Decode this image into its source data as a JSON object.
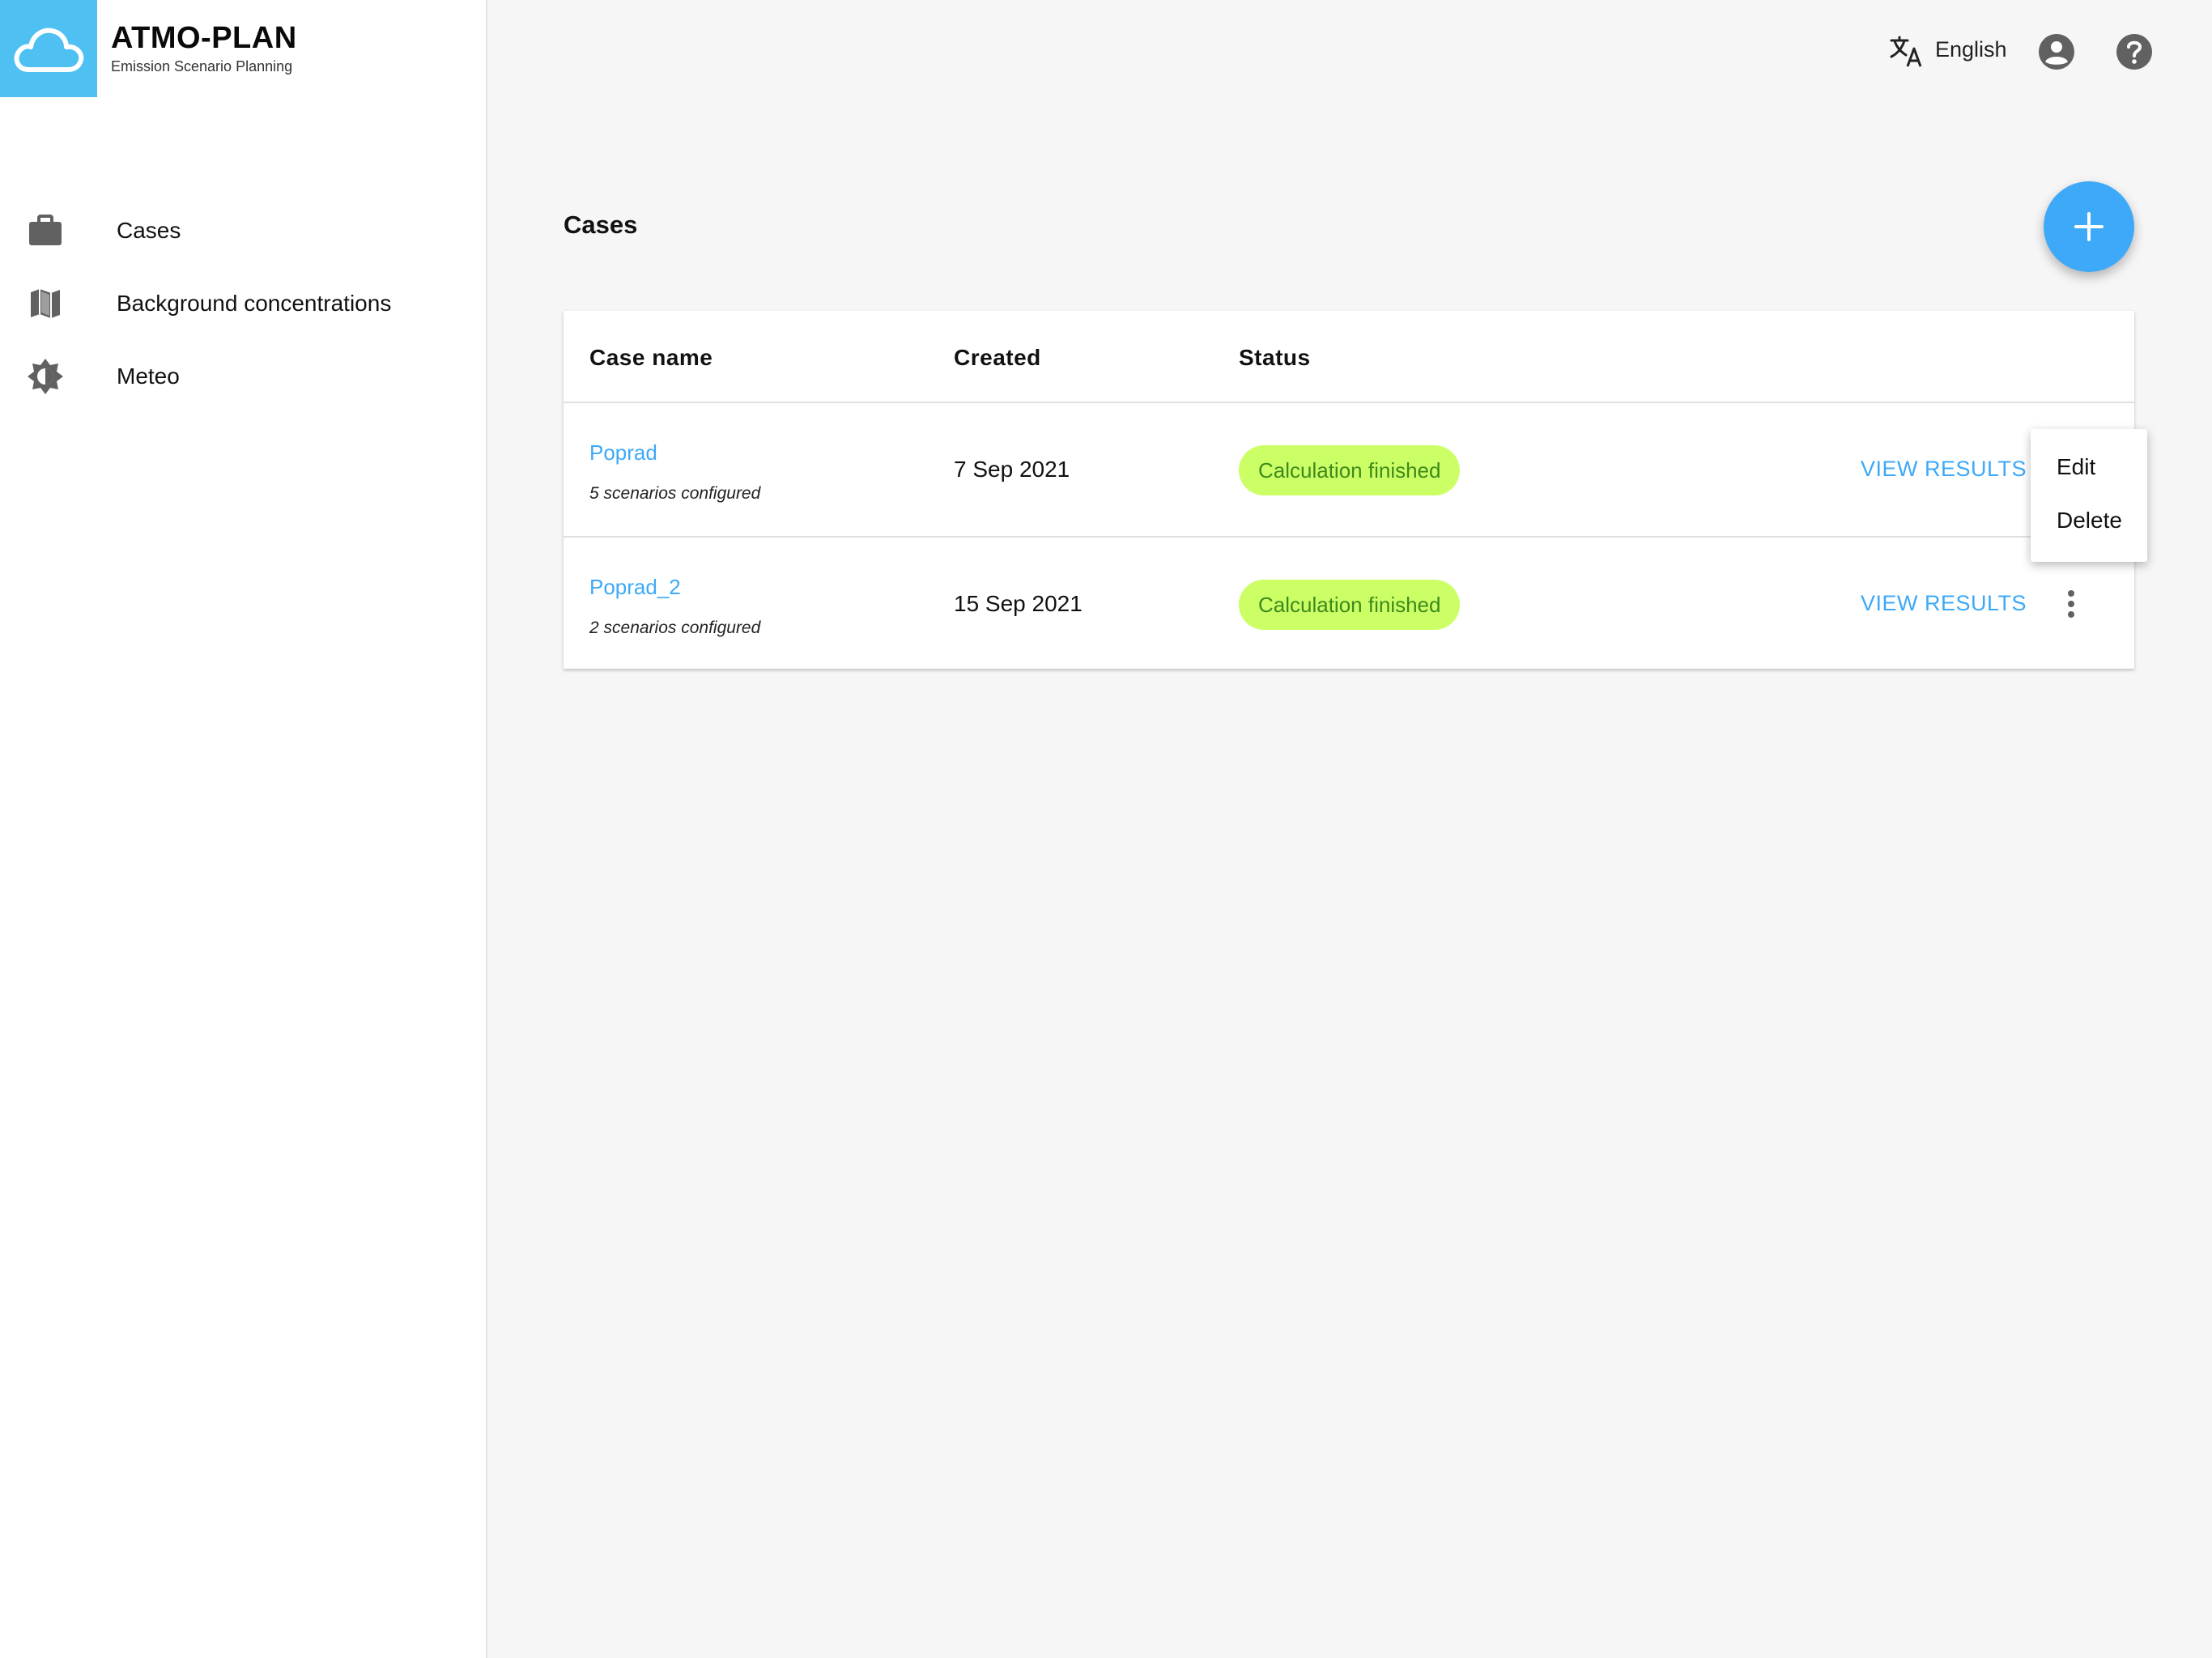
{
  "app": {
    "title": "ATMO-PLAN",
    "subtitle": "Emission Scenario Planning"
  },
  "sidebar": {
    "items": [
      {
        "label": "Cases",
        "icon": "briefcase-icon"
      },
      {
        "label": "Background concentrations",
        "icon": "map-icon"
      },
      {
        "label": "Meteo",
        "icon": "brightness-icon"
      }
    ]
  },
  "topbar": {
    "language": "English",
    "icons": [
      "translate-icon",
      "account-circle-icon",
      "help-circle-icon"
    ]
  },
  "page": {
    "title": "Cases"
  },
  "table": {
    "headers": {
      "name": "Case name",
      "created": "Created",
      "status": "Status"
    },
    "rows": [
      {
        "name": "Poprad",
        "sub": "5 scenarios configured",
        "created": "7 Sep 2021",
        "status": "Calculation finished",
        "action": "VIEW RESULTS"
      },
      {
        "name": "Poprad_2",
        "sub": "2 scenarios configured",
        "created": "15 Sep 2021",
        "status": "Calculation finished",
        "action": "VIEW RESULTS"
      }
    ]
  },
  "context_menu": {
    "items": [
      "Edit",
      "Delete"
    ]
  },
  "colors": {
    "accent": "#3da9f8",
    "logo_bg": "#4ec0f2",
    "status_bg": "#ccff66",
    "status_text": "#3d8a1c"
  }
}
